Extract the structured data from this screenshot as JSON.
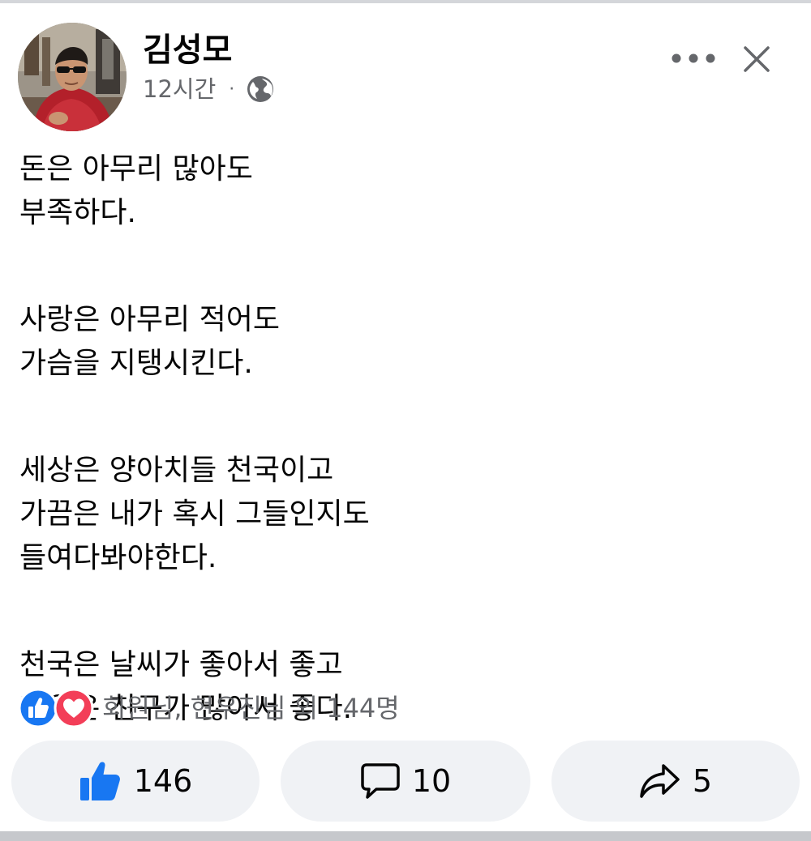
{
  "post": {
    "author": {
      "name": "김성모",
      "avatar_icon": "profile-photo"
    },
    "timestamp": "12시간",
    "separator": "·",
    "privacy_icon": "globe-icon",
    "body": [
      [
        "돈은 아무리 많아도",
        "부족하다."
      ],
      [
        "사랑은 아무리 적어도",
        "가슴을 지탱시킨다."
      ],
      [
        "세상은 양아치들 천국이고",
        "가끔은 내가 혹시 그들인지도",
        "들여다봐야한다."
      ],
      [
        "천국은 날씨가 좋아서 좋고",
        "지옥은 친구가 많아서 좋다."
      ]
    ],
    "reactions": {
      "icons": [
        "like-reaction-icon",
        "love-reaction-icon"
      ],
      "summary": "회원님, 현우진님 외 144명"
    },
    "actions": {
      "like_count": "146",
      "comment_count": "10",
      "share_count": "5"
    },
    "colors": {
      "like_blue": "#1877f2",
      "love_red": "#f33e58",
      "secondary_text": "#65676b",
      "button_bg": "#f0f2f5"
    }
  }
}
